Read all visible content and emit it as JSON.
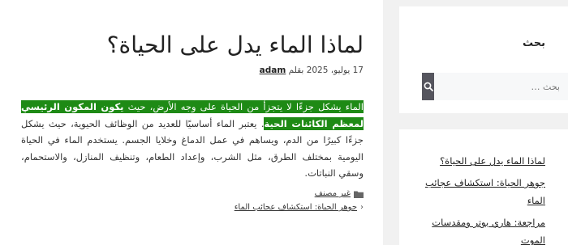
{
  "article": {
    "title": "لماذا الماء يدل على الحياة؟",
    "date": "17 يوليو، 2025",
    "by_label": "بقلم",
    "author": "adam",
    "highlight_part1": "الماء يشكل جزءًا لا يتجزأ من الحياة على وجه الأرض، حيث ",
    "highlight_bold": "يكون المكون الرئيسي لمعظم الكائنات الحية",
    "body_rest": ". يعتبر الماء أساسيًا للعديد من الوظائف الحيوية، حيث يشكل جزءًا كبيرًا من الدم، ويساهم في عمل الدماغ وخلايا الجسم. يستخدم الماء في الحياة اليومية بمختلف الطرق، مثل الشرب، وإعداد الطعام، وتنظيف المنازل، والاستحمام، وسقي النباتات.",
    "category": "غير مصنف",
    "next_post": "جوهر الحياة: استكشاف عجائب الماء"
  },
  "sidebar": {
    "search_title": "بحث",
    "search_placeholder": "بحث …",
    "recent_posts": [
      "لماذا الماء يدل على الحياة؟",
      "جوهر الحياة: استكشاف عجائب الماء",
      "مراجعة: هاري بوتر ومقدسات الموت"
    ]
  },
  "colors": {
    "highlight": "#1e8a15",
    "search_button": "#55555e"
  },
  "icons": {
    "category": "folder-icon",
    "next": "chevron-left-icon",
    "search": "search-icon"
  }
}
